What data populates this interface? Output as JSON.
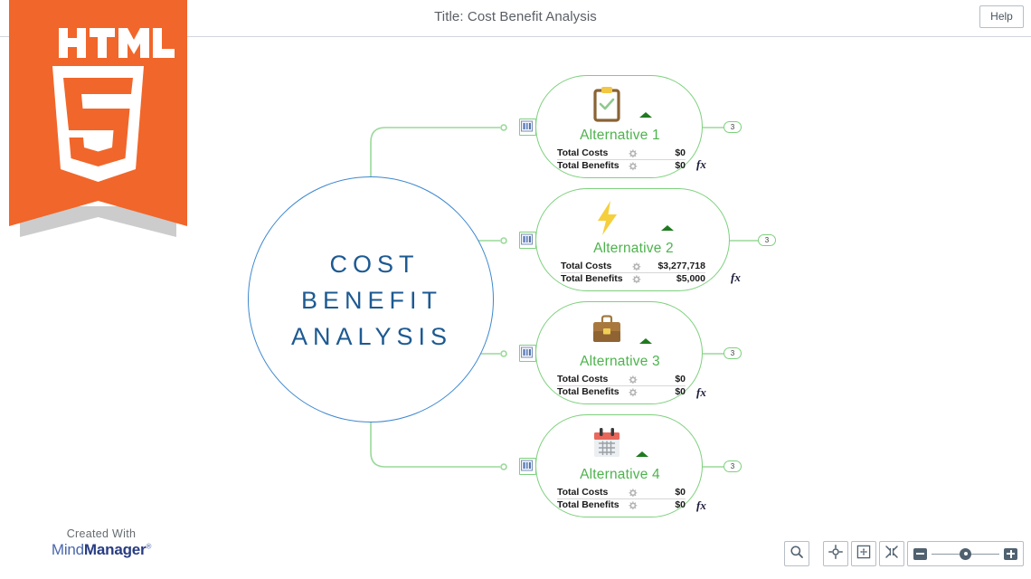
{
  "header": {
    "title": "Title: Cost Benefit Analysis",
    "help_label": "Help"
  },
  "logo": {
    "name": "html5-logo",
    "wordmark": "HTML",
    "version": "5",
    "color": "#f1662a",
    "shadow_color": "#cccccc"
  },
  "map": {
    "central_topic": {
      "label": "COST\nBENEFIT\nANALYSIS",
      "border_color": "#3c87cf",
      "text_color": "#1d5a92"
    },
    "topic_color": "#7ed07e",
    "topic_title_color": "#4db34d",
    "nodes": [
      {
        "title": "Alternative 1",
        "icon": "clipboard-check-icon",
        "fx_label": "fx",
        "badge_count": "3",
        "marker_icon": "chart-marker-icon",
        "stats": [
          {
            "label": "Total Costs",
            "gear": "gear-icon",
            "value": "$0"
          },
          {
            "label": "Total Benefits",
            "gear": "gear-icon",
            "value": "$0"
          }
        ]
      },
      {
        "title": "Alternative 2",
        "icon": "lightning-bolt-icon",
        "fx_label": "fx",
        "badge_count": "3",
        "marker_icon": "chart-marker-icon",
        "stats": [
          {
            "label": "Total Costs",
            "gear": "gear-icon",
            "value": "$3,277,718"
          },
          {
            "label": "Total Benefits",
            "gear": "gear-icon",
            "value": "$5,000"
          }
        ]
      },
      {
        "title": "Alternative 3",
        "icon": "briefcase-icon",
        "fx_label": "fx",
        "badge_count": "3",
        "marker_icon": "chart-marker-icon",
        "stats": [
          {
            "label": "Total Costs",
            "gear": "gear-icon",
            "value": "$0"
          },
          {
            "label": "Total Benefits",
            "gear": "gear-icon",
            "value": "$0"
          }
        ]
      },
      {
        "title": "Alternative 4",
        "icon": "calendar-icon",
        "fx_label": "fx",
        "badge_count": "3",
        "marker_icon": "chart-marker-icon",
        "stats": [
          {
            "label": "Total Costs",
            "gear": "gear-icon",
            "value": "$0"
          },
          {
            "label": "Total Benefits",
            "gear": "gear-icon",
            "value": "$0"
          }
        ]
      }
    ]
  },
  "brand": {
    "created_with": "Created With",
    "name_light": "Mind",
    "name_bold": "Manager",
    "registered": "®"
  },
  "toolbar": {
    "search_icon": "search-icon",
    "center_icon": "center-map-icon",
    "fit_icon": "fit-to-page-icon",
    "collapse_icon": "collapse-icon",
    "zoom_out_icon": "zoom-out-icon",
    "zoom_in_icon": "zoom-in-icon",
    "zoom_value": "50"
  }
}
